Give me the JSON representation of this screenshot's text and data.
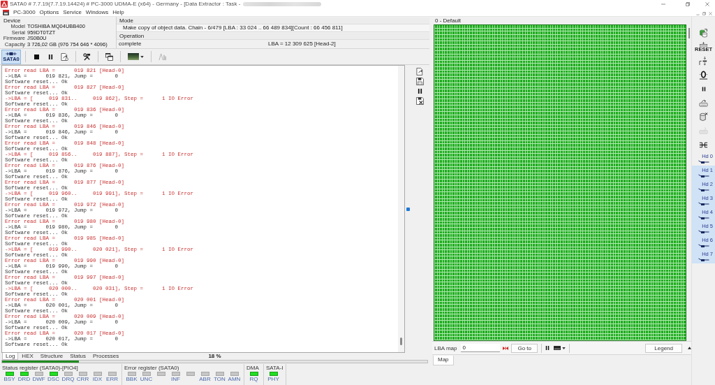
{
  "window": {
    "title": "SATA0 # 7.7.19(7.7.19.14424) # PC-3000 UDMA-E (x64) - Germany - [Data Extractor : Task -"
  },
  "menu": [
    "PC-3000",
    "Options",
    "Service",
    "Windows",
    "Help"
  ],
  "device": {
    "title": "Device",
    "fields": [
      {
        "label": "Model",
        "value": "TOSHIBA MQ04UBB400"
      },
      {
        "label": "Serial",
        "value": "959DT0TZT"
      },
      {
        "label": "Firmware",
        "value": "JS0B0U"
      },
      {
        "label": "Capacity",
        "value": "3 726,02 GB (976 754 646 * 4096)"
      }
    ]
  },
  "mode": {
    "title": "Mode",
    "value": "Make copy of object data. Chain - 6/479 [LBA : 33 024 .. 66 489 834][Count : 66 456 811]"
  },
  "operation": {
    "title": "Operation",
    "status": "complete",
    "lba": "LBA = 12 309 625 [Head-2]"
  },
  "toolbar": [
    [
      {
        "kind": "port",
        "label": "SATA0",
        "selected": true,
        "disabled": false
      }
    ],
    [
      {
        "kind": "stop",
        "selected": false,
        "disabled": false
      },
      {
        "kind": "pause",
        "selected": false,
        "disabled": false
      },
      {
        "kind": "document",
        "selected": false,
        "disabled": false
      }
    ],
    [
      {
        "kind": "tools",
        "selected": false,
        "disabled": false
      }
    ],
    [
      {
        "kind": "windows",
        "selected": false,
        "disabled": false
      }
    ],
    [
      {
        "kind": "image-menu",
        "selected": false,
        "disabled": false
      }
    ],
    [
      {
        "kind": "chart",
        "selected": false,
        "disabled": true
      }
    ]
  ],
  "log": {
    "lines": [
      {
        "kind": "error",
        "text": "Error read LBA =      019 821 [Head-0]"
      },
      {
        "kind": "info",
        "text": "->LBA =      019 821, Jump =       0"
      },
      {
        "kind": "info",
        "text": "Software reset... Ok"
      },
      {
        "kind": "error",
        "text": "Error read LBA =      019 827 [Head-0]"
      },
      {
        "kind": "info",
        "text": "Software reset... Ok"
      },
      {
        "kind": "error",
        "text": "->LBA = [     019 831..     019 862], Step =      1 IO Error"
      },
      {
        "kind": "info",
        "text": "Software reset... Ok"
      },
      {
        "kind": "error",
        "text": "Error read LBA =      019 836 [Head-0]"
      },
      {
        "kind": "info",
        "text": "->LBA =      019 836, Jump =       0"
      },
      {
        "kind": "info",
        "text": "Software reset... Ok"
      },
      {
        "kind": "error",
        "text": "Error read LBA =      019 846 [Head-0]"
      },
      {
        "kind": "info",
        "text": "->LBA =      019 846, Jump =       0"
      },
      {
        "kind": "info",
        "text": "Software reset... Ok"
      },
      {
        "kind": "error",
        "text": "Error read LBA =      019 848 [Head-0]"
      },
      {
        "kind": "info",
        "text": "Software reset... Ok"
      },
      {
        "kind": "error",
        "text": "->LBA = [     019 856..     019 887], Step =      1 IO Error"
      },
      {
        "kind": "info",
        "text": "Software reset... Ok"
      },
      {
        "kind": "error",
        "text": "Error read LBA =      019 876 [Head-0]"
      },
      {
        "kind": "info",
        "text": "->LBA =      019 876, Jump =       0"
      },
      {
        "kind": "info",
        "text": "Software reset... Ok"
      },
      {
        "kind": "error",
        "text": "Error read LBA =      019 877 [Head-0]"
      },
      {
        "kind": "info",
        "text": "Software reset... Ok"
      },
      {
        "kind": "error",
        "text": "->LBA = [     019 960..     019 991], Step =      1 IO Error"
      },
      {
        "kind": "info",
        "text": "Software reset... Ok"
      },
      {
        "kind": "error",
        "text": "Error read LBA =      019 972 [Head-0]"
      },
      {
        "kind": "info",
        "text": "->LBA =      019 972, Jump =       0"
      },
      {
        "kind": "info",
        "text": "Software reset... Ok"
      },
      {
        "kind": "error",
        "text": "Error read LBA =      019 980 [Head-0]"
      },
      {
        "kind": "info",
        "text": "->LBA =      019 980, Jump =       0"
      },
      {
        "kind": "info",
        "text": "Software reset... Ok"
      },
      {
        "kind": "error",
        "text": "Error read LBA =      019 985 [Head-0]"
      },
      {
        "kind": "info",
        "text": "Software reset... Ok"
      },
      {
        "kind": "error",
        "text": "->LBA = [     019 990..     020 021], Step =      1 IO Error"
      },
      {
        "kind": "info",
        "text": "Software reset... Ok"
      },
      {
        "kind": "error",
        "text": "Error read LBA =      019 990 [Head-0]"
      },
      {
        "kind": "info",
        "text": "->LBA =      019 990, Jump =       0"
      },
      {
        "kind": "info",
        "text": "Software reset... Ok"
      },
      {
        "kind": "error",
        "text": "Error read LBA =      019 997 [Head-0]"
      },
      {
        "kind": "info",
        "text": "Software reset... Ok"
      },
      {
        "kind": "error",
        "text": "->LBA = [     020 000..     020 031], Step =      1 IO Error"
      },
      {
        "kind": "info",
        "text": "Software reset... Ok"
      },
      {
        "kind": "error",
        "text": "Error read LBA =      020 001 [Head-0]"
      },
      {
        "kind": "info",
        "text": "->LBA =      020 001, Jump =       0"
      },
      {
        "kind": "info",
        "text": "Software reset... Ok"
      },
      {
        "kind": "error",
        "text": "Error read LBA =      020 009 [Head-0]"
      },
      {
        "kind": "info",
        "text": "->LBA =      020 009, Jump =       0"
      },
      {
        "kind": "info",
        "text": "Software reset... Ok"
      },
      {
        "kind": "error",
        "text": "Error read LBA =      020 017 [Head-0]"
      },
      {
        "kind": "info",
        "text": "->LBA =      020 017, Jump =       0"
      },
      {
        "kind": "info",
        "text": "Software reset... Ok"
      }
    ],
    "tabs": [
      {
        "label": "Log",
        "selected": true
      },
      {
        "label": "HEX",
        "selected": false
      },
      {
        "label": "Structure",
        "selected": false
      },
      {
        "label": "Status",
        "selected": false
      },
      {
        "label": "Processes",
        "selected": false
      }
    ],
    "progress": {
      "label": "18 %",
      "level": 0.18
    }
  },
  "registers": [
    {
      "title": "Status register (SATA0)-[PIO4]",
      "bits": [
        {
          "label": "BSY",
          "on": true
        },
        {
          "label": "DRD",
          "on": true
        },
        {
          "label": "DWF",
          "on": false
        },
        {
          "label": "DSC",
          "on": true
        },
        {
          "label": "DRQ",
          "on": false
        },
        {
          "label": "CRR",
          "on": false
        },
        {
          "label": "IDX",
          "on": false
        },
        {
          "label": "ERR",
          "on": false
        }
      ]
    },
    {
      "title": "Error register (SATA0)",
      "bits": [
        {
          "label": "BBK",
          "on": false
        },
        {
          "label": "UNC",
          "on": false
        },
        {
          "on": false
        },
        {
          "label": "INF",
          "on": false
        },
        {
          "on": false
        },
        {
          "label": "ABR",
          "on": false
        },
        {
          "label": "TON",
          "on": false
        },
        {
          "label": "AMN",
          "on": false
        }
      ]
    },
    {
      "title": "DMA",
      "bits": [
        {
          "label": "RQ",
          "on": true
        }
      ]
    },
    {
      "title": "SATA-I",
      "bits": [
        {
          "label": "PHY",
          "on": true
        }
      ]
    }
  ],
  "map": {
    "title": "0 - Default",
    "lba_label": "LBA map",
    "lba_value": "0",
    "goto": "Go to",
    "legend": "Legend",
    "tabs": [
      {
        "label": "Map",
        "selected": true
      }
    ]
  },
  "side_tools": [
    {
      "kind": "disk-copy",
      "disabled": false
    },
    {
      "kind": "reset",
      "label": "RESET",
      "disabled": false
    },
    {
      "kind": "head-step",
      "disabled": false
    },
    {
      "kind": "zero",
      "disabled": false
    },
    {
      "kind": "pause",
      "disabled": false
    },
    {
      "kind": "drive-arrow",
      "disabled": false
    },
    {
      "kind": "cylinder",
      "disabled": false
    },
    {
      "kind": "drive",
      "disabled": true
    },
    {
      "kind": "connector",
      "disabled": false
    }
  ],
  "heads": [
    {
      "label": "Hd 0",
      "selected": false
    },
    {
      "label": "Hd 1",
      "selected": true
    },
    {
      "label": "Hd 2",
      "selected": true
    },
    {
      "label": "Hd 3",
      "selected": true
    },
    {
      "label": "Hd 4",
      "selected": true
    },
    {
      "label": "Hd 5",
      "selected": true
    },
    {
      "label": "Hd 6",
      "selected": true
    },
    {
      "label": "Hd 7",
      "selected": true
    }
  ]
}
